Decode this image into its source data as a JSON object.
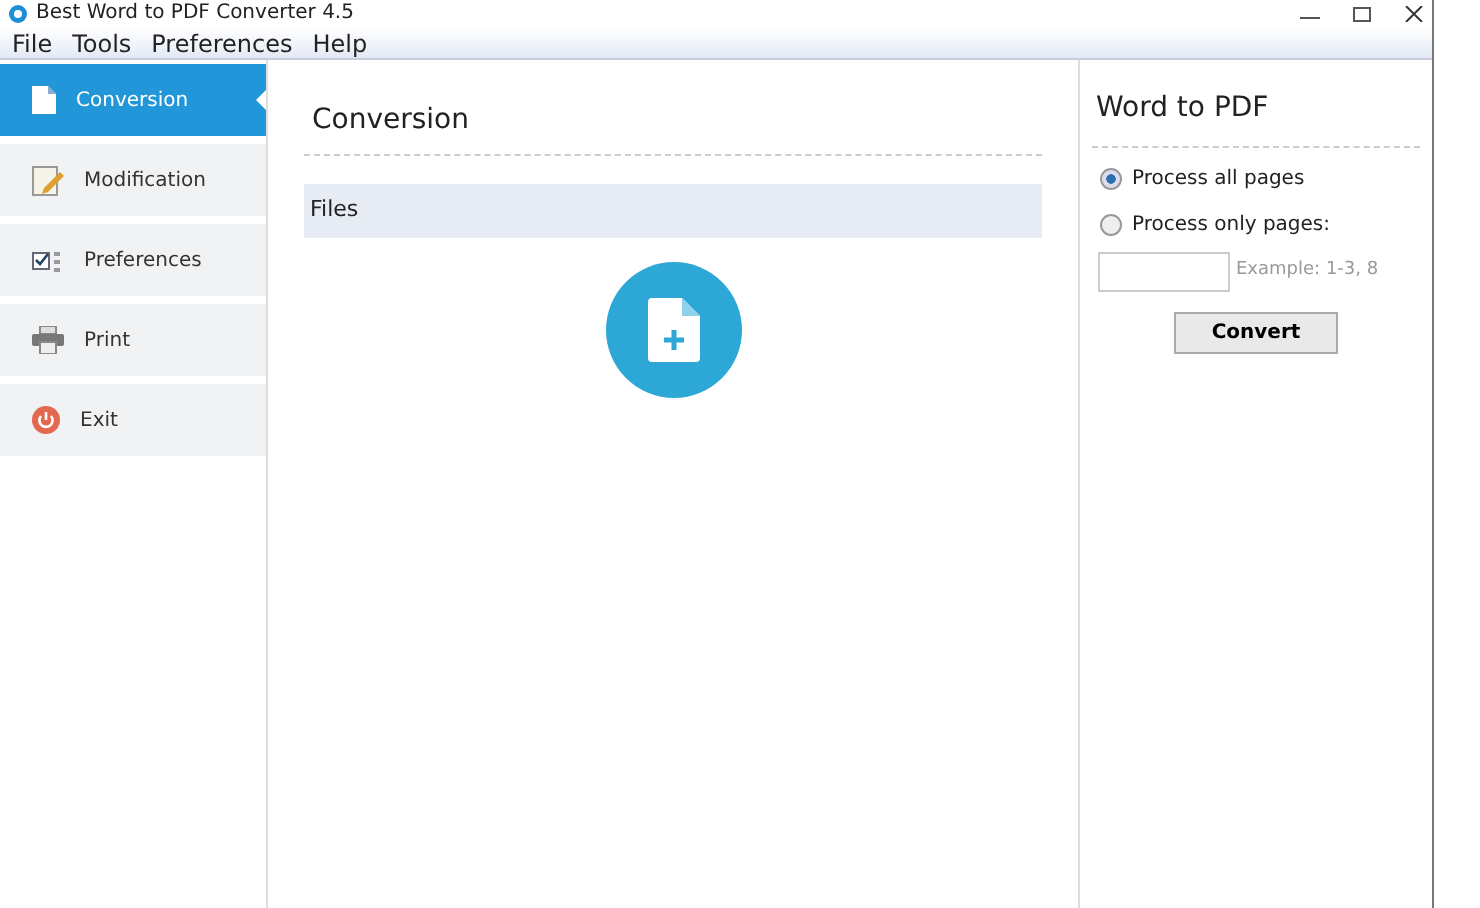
{
  "window": {
    "title": "Best Word to PDF Converter 4.5"
  },
  "menu": [
    "File",
    "Tools",
    "Preferences",
    "Help"
  ],
  "sidebar": {
    "items": [
      {
        "label": "Conversion",
        "kind": "document",
        "selected": true
      },
      {
        "label": "Modification",
        "kind": "pencil",
        "selected": false
      },
      {
        "label": "Preferences",
        "kind": "checklist",
        "selected": false
      },
      {
        "label": "Print",
        "kind": "printer",
        "selected": false
      },
      {
        "label": "Exit",
        "kind": "power",
        "selected": false
      }
    ]
  },
  "main": {
    "title": "Conversion",
    "files_header": "Files"
  },
  "panel": {
    "title": "Word to PDF",
    "options": [
      {
        "label": "Process all pages",
        "selected": true
      },
      {
        "label": "Process only pages:",
        "selected": false
      }
    ],
    "pages_field": {
      "hint": "Example: 1-3, 8"
    },
    "button": "Convert"
  }
}
